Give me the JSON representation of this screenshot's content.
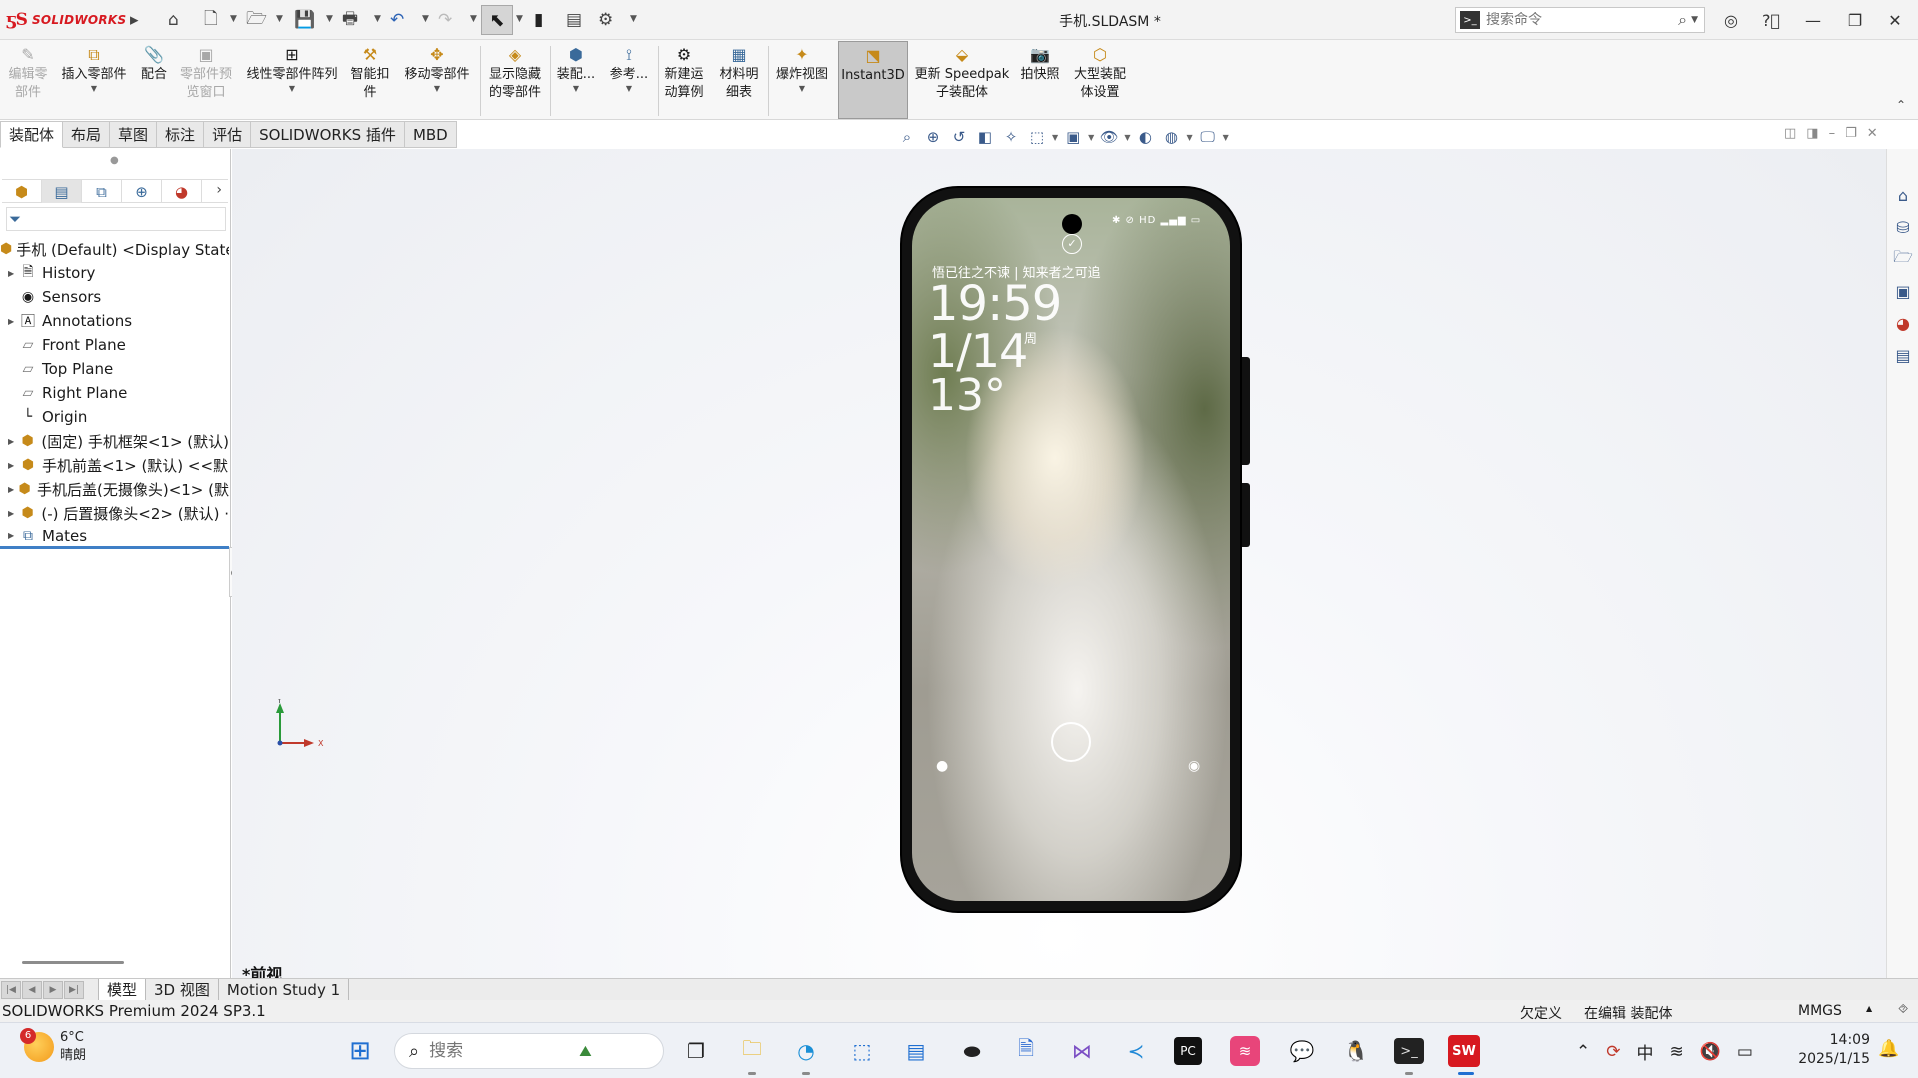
{
  "titlebar": {
    "logo_ds": "ƽS",
    "logo_text": "SOLIDWORKS",
    "document_title": "手机.SLDASM *",
    "search_placeholder": "搜索命令"
  },
  "commands": [
    {
      "label": "编辑零\n部件",
      "icon": "edit-component-icon",
      "disabled": true
    },
    {
      "label": "插入零部件",
      "icon": "insert-component-icon",
      "disabled": false
    },
    {
      "label": "配合",
      "icon": "mate-icon",
      "disabled": false
    },
    {
      "label": "零部件预\n览窗口",
      "icon": "component-preview-icon",
      "disabled": true
    },
    {
      "label": "线性零部件阵列",
      "icon": "linear-pattern-icon",
      "disabled": false
    },
    {
      "label": "智能扣\n件",
      "icon": "smart-fasteners-icon",
      "disabled": false
    },
    {
      "label": "移动零部件",
      "icon": "move-component-icon",
      "disabled": false
    },
    {
      "label": "显示隐藏\n的零部件",
      "icon": "show-hidden-icon",
      "disabled": false
    },
    {
      "label": "装配...",
      "icon": "assembly-features-icon",
      "disabled": false
    },
    {
      "label": "参考...",
      "icon": "reference-geometry-icon",
      "disabled": false
    },
    {
      "label": "新建运\n动算例",
      "icon": "new-motion-study-icon",
      "disabled": false
    },
    {
      "label": "材料明\n细表",
      "icon": "bom-icon",
      "disabled": false
    },
    {
      "label": "爆炸视图",
      "icon": "exploded-view-icon",
      "disabled": false
    },
    {
      "label": "Instant3D",
      "icon": "instant3d-icon",
      "disabled": false,
      "active": true
    },
    {
      "label": "更新 Speedpak\n子装配体",
      "icon": "speedpak-icon",
      "disabled": false
    },
    {
      "label": "拍快照",
      "icon": "snapshot-icon",
      "disabled": false
    },
    {
      "label": "大型装配\n体设置",
      "icon": "large-assembly-icon",
      "disabled": false
    }
  ],
  "tabs": [
    "装配体",
    "布局",
    "草图",
    "标注",
    "评估",
    "SOLIDWORKS 插件",
    "MBD"
  ],
  "tree": {
    "root": "手机 (Default) <Display State",
    "items": [
      {
        "label": "History",
        "icon": "history-icon",
        "expandable": true
      },
      {
        "label": "Sensors",
        "icon": "sensors-icon",
        "expandable": false
      },
      {
        "label": "Annotations",
        "icon": "annotations-icon",
        "expandable": true
      },
      {
        "label": "Front Plane",
        "icon": "plane-icon",
        "expandable": false
      },
      {
        "label": "Top Plane",
        "icon": "plane-icon",
        "expandable": false
      },
      {
        "label": "Right Plane",
        "icon": "plane-icon",
        "expandable": false
      },
      {
        "label": "Origin",
        "icon": "origin-icon",
        "expandable": false
      },
      {
        "label": "(固定) 手机框架<1> (默认)",
        "icon": "part-icon",
        "expandable": true
      },
      {
        "label": "手机前盖<1> (默认) <<默",
        "icon": "part-icon",
        "expandable": true
      },
      {
        "label": "手机后盖(无摄像头)<1> (默",
        "icon": "part-icon",
        "expandable": true
      },
      {
        "label": "(-) 后置摄像头<2> (默认) ·",
        "icon": "part-icon",
        "expandable": true
      },
      {
        "label": "Mates",
        "icon": "mates-icon",
        "expandable": true
      }
    ]
  },
  "viewport": {
    "view_name": "*前视",
    "axis_y": "Y",
    "axis_x": "X"
  },
  "phone_screen": {
    "quote": "悟已往之不谏 | 知来者之可追",
    "time": "19:59",
    "date": "1/14",
    "weekday": "周",
    "temp": "13°",
    "status_icons": "✱ ⊘ HD ▂▄▆ ▭"
  },
  "bottom_tabs": [
    "模型",
    "3D 视图",
    "Motion Study 1"
  ],
  "statusbar": {
    "product": "SOLIDWORKS Premium 2024 SP3.1",
    "definition": "欠定义",
    "editing": "在编辑 装配体",
    "units": "MMGS"
  },
  "taskbar": {
    "weather_badge": "6",
    "weather_temp": "6°C",
    "weather_desc": "晴朗",
    "search_placeholder": "搜索",
    "ime": "中",
    "time": "14:09",
    "date": "2025/1/15"
  }
}
